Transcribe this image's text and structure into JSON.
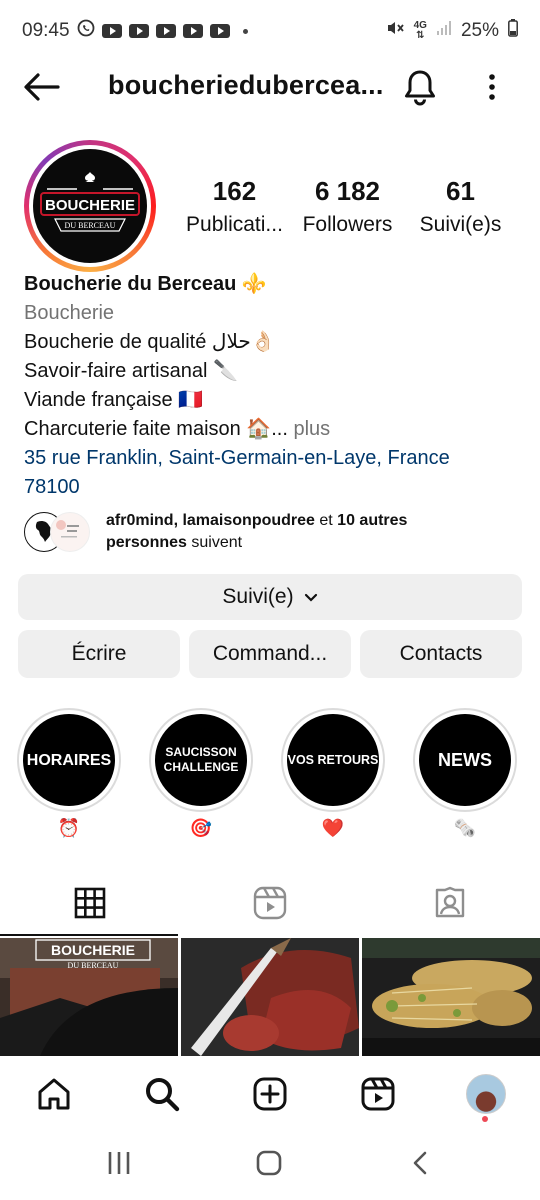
{
  "status_bar": {
    "time": "09:45",
    "battery": "25%",
    "network": "4G"
  },
  "header": {
    "username": "boucheriedubercea...",
    "back_icon": "back-arrow-icon",
    "bell_icon": "bell-icon",
    "more_icon": "more-vertical-icon"
  },
  "profile": {
    "avatar_text_top": "BOUCHERIE",
    "avatar_text_bottom": "DU BERCEAU",
    "stats": [
      {
        "value": "162",
        "label": "Publicati..."
      },
      {
        "value": "6 182",
        "label": "Followers"
      },
      {
        "value": "61",
        "label": "Suivi(e)s"
      }
    ]
  },
  "bio": {
    "name": "Boucherie du Berceau ⚜️",
    "category": "Boucherie",
    "lines": [
      "Boucherie de qualité حلال👌🏻",
      "Savoir-faire artisanal 🔪",
      "Viande française 🇫🇷",
      "Charcuterie faite maison 🏠..."
    ],
    "more": "plus",
    "address_line1": "35 rue Franklin, Saint-Germain-en-Laye, France",
    "address_line2": "78100"
  },
  "followed_by": {
    "names": "afr0mind, lamaisonpoudree",
    "mid": " et ",
    "others": "10 autres",
    "line2_bold": "personnes",
    "line2_rest": " suivent"
  },
  "buttons": {
    "follow": "Suivi(e)",
    "write": "Écrire",
    "order": "Command...",
    "contacts": "Contacts"
  },
  "highlights": [
    {
      "title": "HORAIRES",
      "emoji": "⏰"
    },
    {
      "title": "SAUCISSON CHALLENGE",
      "emoji": "🎯"
    },
    {
      "title": "VOS RETOURS",
      "emoji": "❤️"
    },
    {
      "title": "NEWS",
      "emoji": "🗞️"
    }
  ],
  "grid": {
    "post1_text_top": "BOUCHERIE",
    "post1_text_bottom": "DU BERCEAU"
  },
  "colors": {
    "link": "#00376b",
    "muted": "#737373",
    "button_bg": "#efefef",
    "notification": "#ed4956"
  }
}
